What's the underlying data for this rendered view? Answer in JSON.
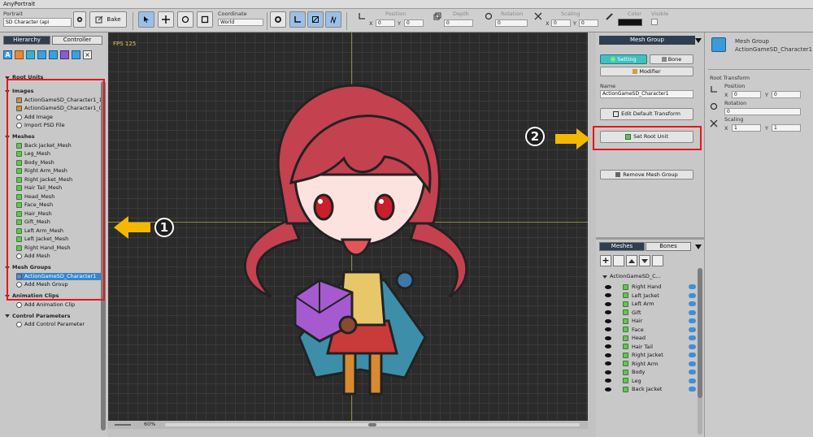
{
  "window": {
    "title": "AnyPortrait"
  },
  "toolbar": {
    "portrait_label": "Portrait",
    "portrait_value": "SD Character (api",
    "bake_label": "Bake",
    "coordinate_label": "Coordinate",
    "coordinate_value": "World",
    "position_label": "Position",
    "depth_label": "Depth",
    "rotation_label": "Rotation",
    "scaling_label": "Scaling",
    "color_label": "Color",
    "visible_label": "Visible",
    "x_label": "X",
    "y_label": "Y",
    "pos_x": "0",
    "pos_y": "0",
    "depth": "0",
    "rotation": "0",
    "scale_x": "0",
    "scale_y": "0"
  },
  "left": {
    "tab_hierarchy": "Hierarchy",
    "tab_controller": "Controller",
    "root_units": "Root Units",
    "images_header": "Images",
    "images": [
      "ActionGameSD_Character1_1",
      "ActionGameSD_Character1_0"
    ],
    "add_image": "Add Image",
    "import_psd": "Import PSD File",
    "meshes_header": "Meshes",
    "meshes": [
      "Back Jacket_Mesh",
      "Leg_Mesh",
      "Body_Mesh",
      "Right Arm_Mesh",
      "Right Jacket_Mesh",
      "Hair Tail_Mesh",
      "Head_Mesh",
      "Face_Mesh",
      "Hair_Mesh",
      "Gift_Mesh",
      "Left Arm_Mesh",
      "Left Jacket_Mesh",
      "Right Hand_Mesh"
    ],
    "add_mesh": "Add Mesh",
    "mesh_groups_header": "Mesh Groups",
    "mesh_group_item": "ActionGameSD_Character1",
    "add_mesh_group": "Add Mesh Group",
    "anim_header": "Animation Clips",
    "add_anim": "Add Animation Clip",
    "params_header": "Control Parameters",
    "add_param": "Add Control Parameter"
  },
  "viewport": {
    "fps": "FPS 125",
    "zoom": "60%"
  },
  "right": {
    "mesh_group_title": "Mesh Group",
    "setting_tab": "Setting",
    "bone_tab": "Bone",
    "modifier_btn": "Modifier",
    "name_label": "Name",
    "name_value": "ActionGameSD_Character1",
    "edit_default_transform": "Edit Default Transform",
    "set_root_unit": "Set Root Unit",
    "remove_mesh_group": "Remove Mesh Group",
    "meshes_tab": "Meshes",
    "bones_tab": "Bones",
    "group_node": "ActionGameSD_C...",
    "layer_items": [
      "Right Hand",
      "Left Jacket",
      "Left Arm",
      "Gift",
      "Hair",
      "Face",
      "Head",
      "Hair Tail",
      "Right Jacket",
      "Right Arm",
      "Body",
      "Leg",
      "Back Jacket"
    ]
  },
  "inspector": {
    "title": "Mesh Group",
    "subtitle": "ActionGameSD_Character1",
    "root_transform": "Root Transform",
    "position_label": "Position",
    "rotation_label": "Rotation",
    "scaling_label": "Scaling",
    "x_label": "X",
    "y_label": "Y",
    "pos_x": "0",
    "pos_y": "0",
    "rotation": "0",
    "scale_x": "1",
    "scale_y": "1"
  },
  "callouts": {
    "one": "1",
    "two": "2"
  },
  "colors": {
    "highlight": "#e8161b",
    "arrow": "#f5b800",
    "selection": "#3a86c8",
    "dark_tab": "#2f3e50"
  }
}
